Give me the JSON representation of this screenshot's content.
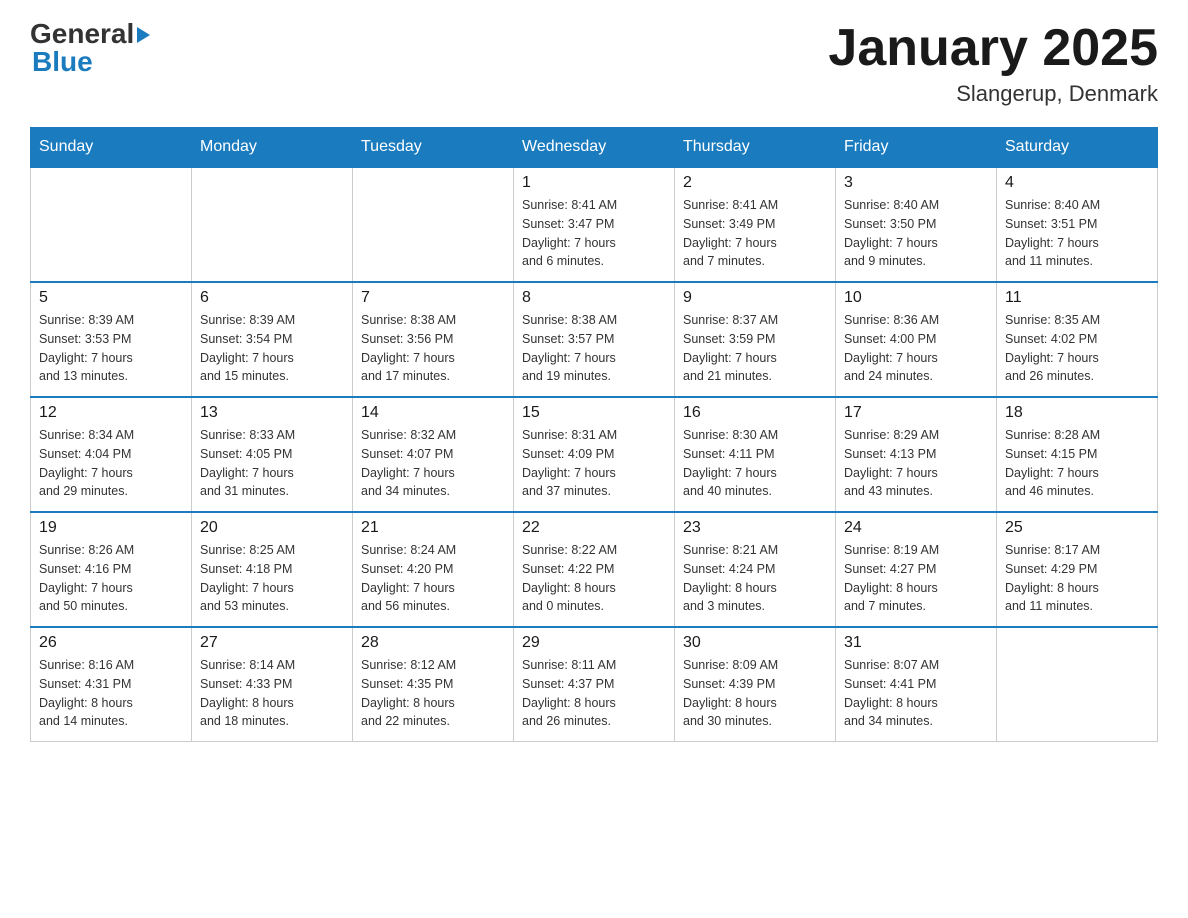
{
  "header": {
    "logo_text_general": "General",
    "logo_text_blue": "Blue",
    "title": "January 2025",
    "subtitle": "Slangerup, Denmark"
  },
  "days_of_week": [
    "Sunday",
    "Monday",
    "Tuesday",
    "Wednesday",
    "Thursday",
    "Friday",
    "Saturday"
  ],
  "weeks": [
    [
      {
        "day": "",
        "info": ""
      },
      {
        "day": "",
        "info": ""
      },
      {
        "day": "",
        "info": ""
      },
      {
        "day": "1",
        "info": "Sunrise: 8:41 AM\nSunset: 3:47 PM\nDaylight: 7 hours\nand 6 minutes."
      },
      {
        "day": "2",
        "info": "Sunrise: 8:41 AM\nSunset: 3:49 PM\nDaylight: 7 hours\nand 7 minutes."
      },
      {
        "day": "3",
        "info": "Sunrise: 8:40 AM\nSunset: 3:50 PM\nDaylight: 7 hours\nand 9 minutes."
      },
      {
        "day": "4",
        "info": "Sunrise: 8:40 AM\nSunset: 3:51 PM\nDaylight: 7 hours\nand 11 minutes."
      }
    ],
    [
      {
        "day": "5",
        "info": "Sunrise: 8:39 AM\nSunset: 3:53 PM\nDaylight: 7 hours\nand 13 minutes."
      },
      {
        "day": "6",
        "info": "Sunrise: 8:39 AM\nSunset: 3:54 PM\nDaylight: 7 hours\nand 15 minutes."
      },
      {
        "day": "7",
        "info": "Sunrise: 8:38 AM\nSunset: 3:56 PM\nDaylight: 7 hours\nand 17 minutes."
      },
      {
        "day": "8",
        "info": "Sunrise: 8:38 AM\nSunset: 3:57 PM\nDaylight: 7 hours\nand 19 minutes."
      },
      {
        "day": "9",
        "info": "Sunrise: 8:37 AM\nSunset: 3:59 PM\nDaylight: 7 hours\nand 21 minutes."
      },
      {
        "day": "10",
        "info": "Sunrise: 8:36 AM\nSunset: 4:00 PM\nDaylight: 7 hours\nand 24 minutes."
      },
      {
        "day": "11",
        "info": "Sunrise: 8:35 AM\nSunset: 4:02 PM\nDaylight: 7 hours\nand 26 minutes."
      }
    ],
    [
      {
        "day": "12",
        "info": "Sunrise: 8:34 AM\nSunset: 4:04 PM\nDaylight: 7 hours\nand 29 minutes."
      },
      {
        "day": "13",
        "info": "Sunrise: 8:33 AM\nSunset: 4:05 PM\nDaylight: 7 hours\nand 31 minutes."
      },
      {
        "day": "14",
        "info": "Sunrise: 8:32 AM\nSunset: 4:07 PM\nDaylight: 7 hours\nand 34 minutes."
      },
      {
        "day": "15",
        "info": "Sunrise: 8:31 AM\nSunset: 4:09 PM\nDaylight: 7 hours\nand 37 minutes."
      },
      {
        "day": "16",
        "info": "Sunrise: 8:30 AM\nSunset: 4:11 PM\nDaylight: 7 hours\nand 40 minutes."
      },
      {
        "day": "17",
        "info": "Sunrise: 8:29 AM\nSunset: 4:13 PM\nDaylight: 7 hours\nand 43 minutes."
      },
      {
        "day": "18",
        "info": "Sunrise: 8:28 AM\nSunset: 4:15 PM\nDaylight: 7 hours\nand 46 minutes."
      }
    ],
    [
      {
        "day": "19",
        "info": "Sunrise: 8:26 AM\nSunset: 4:16 PM\nDaylight: 7 hours\nand 50 minutes."
      },
      {
        "day": "20",
        "info": "Sunrise: 8:25 AM\nSunset: 4:18 PM\nDaylight: 7 hours\nand 53 minutes."
      },
      {
        "day": "21",
        "info": "Sunrise: 8:24 AM\nSunset: 4:20 PM\nDaylight: 7 hours\nand 56 minutes."
      },
      {
        "day": "22",
        "info": "Sunrise: 8:22 AM\nSunset: 4:22 PM\nDaylight: 8 hours\nand 0 minutes."
      },
      {
        "day": "23",
        "info": "Sunrise: 8:21 AM\nSunset: 4:24 PM\nDaylight: 8 hours\nand 3 minutes."
      },
      {
        "day": "24",
        "info": "Sunrise: 8:19 AM\nSunset: 4:27 PM\nDaylight: 8 hours\nand 7 minutes."
      },
      {
        "day": "25",
        "info": "Sunrise: 8:17 AM\nSunset: 4:29 PM\nDaylight: 8 hours\nand 11 minutes."
      }
    ],
    [
      {
        "day": "26",
        "info": "Sunrise: 8:16 AM\nSunset: 4:31 PM\nDaylight: 8 hours\nand 14 minutes."
      },
      {
        "day": "27",
        "info": "Sunrise: 8:14 AM\nSunset: 4:33 PM\nDaylight: 8 hours\nand 18 minutes."
      },
      {
        "day": "28",
        "info": "Sunrise: 8:12 AM\nSunset: 4:35 PM\nDaylight: 8 hours\nand 22 minutes."
      },
      {
        "day": "29",
        "info": "Sunrise: 8:11 AM\nSunset: 4:37 PM\nDaylight: 8 hours\nand 26 minutes."
      },
      {
        "day": "30",
        "info": "Sunrise: 8:09 AM\nSunset: 4:39 PM\nDaylight: 8 hours\nand 30 minutes."
      },
      {
        "day": "31",
        "info": "Sunrise: 8:07 AM\nSunset: 4:41 PM\nDaylight: 8 hours\nand 34 minutes."
      },
      {
        "day": "",
        "info": ""
      }
    ]
  ]
}
